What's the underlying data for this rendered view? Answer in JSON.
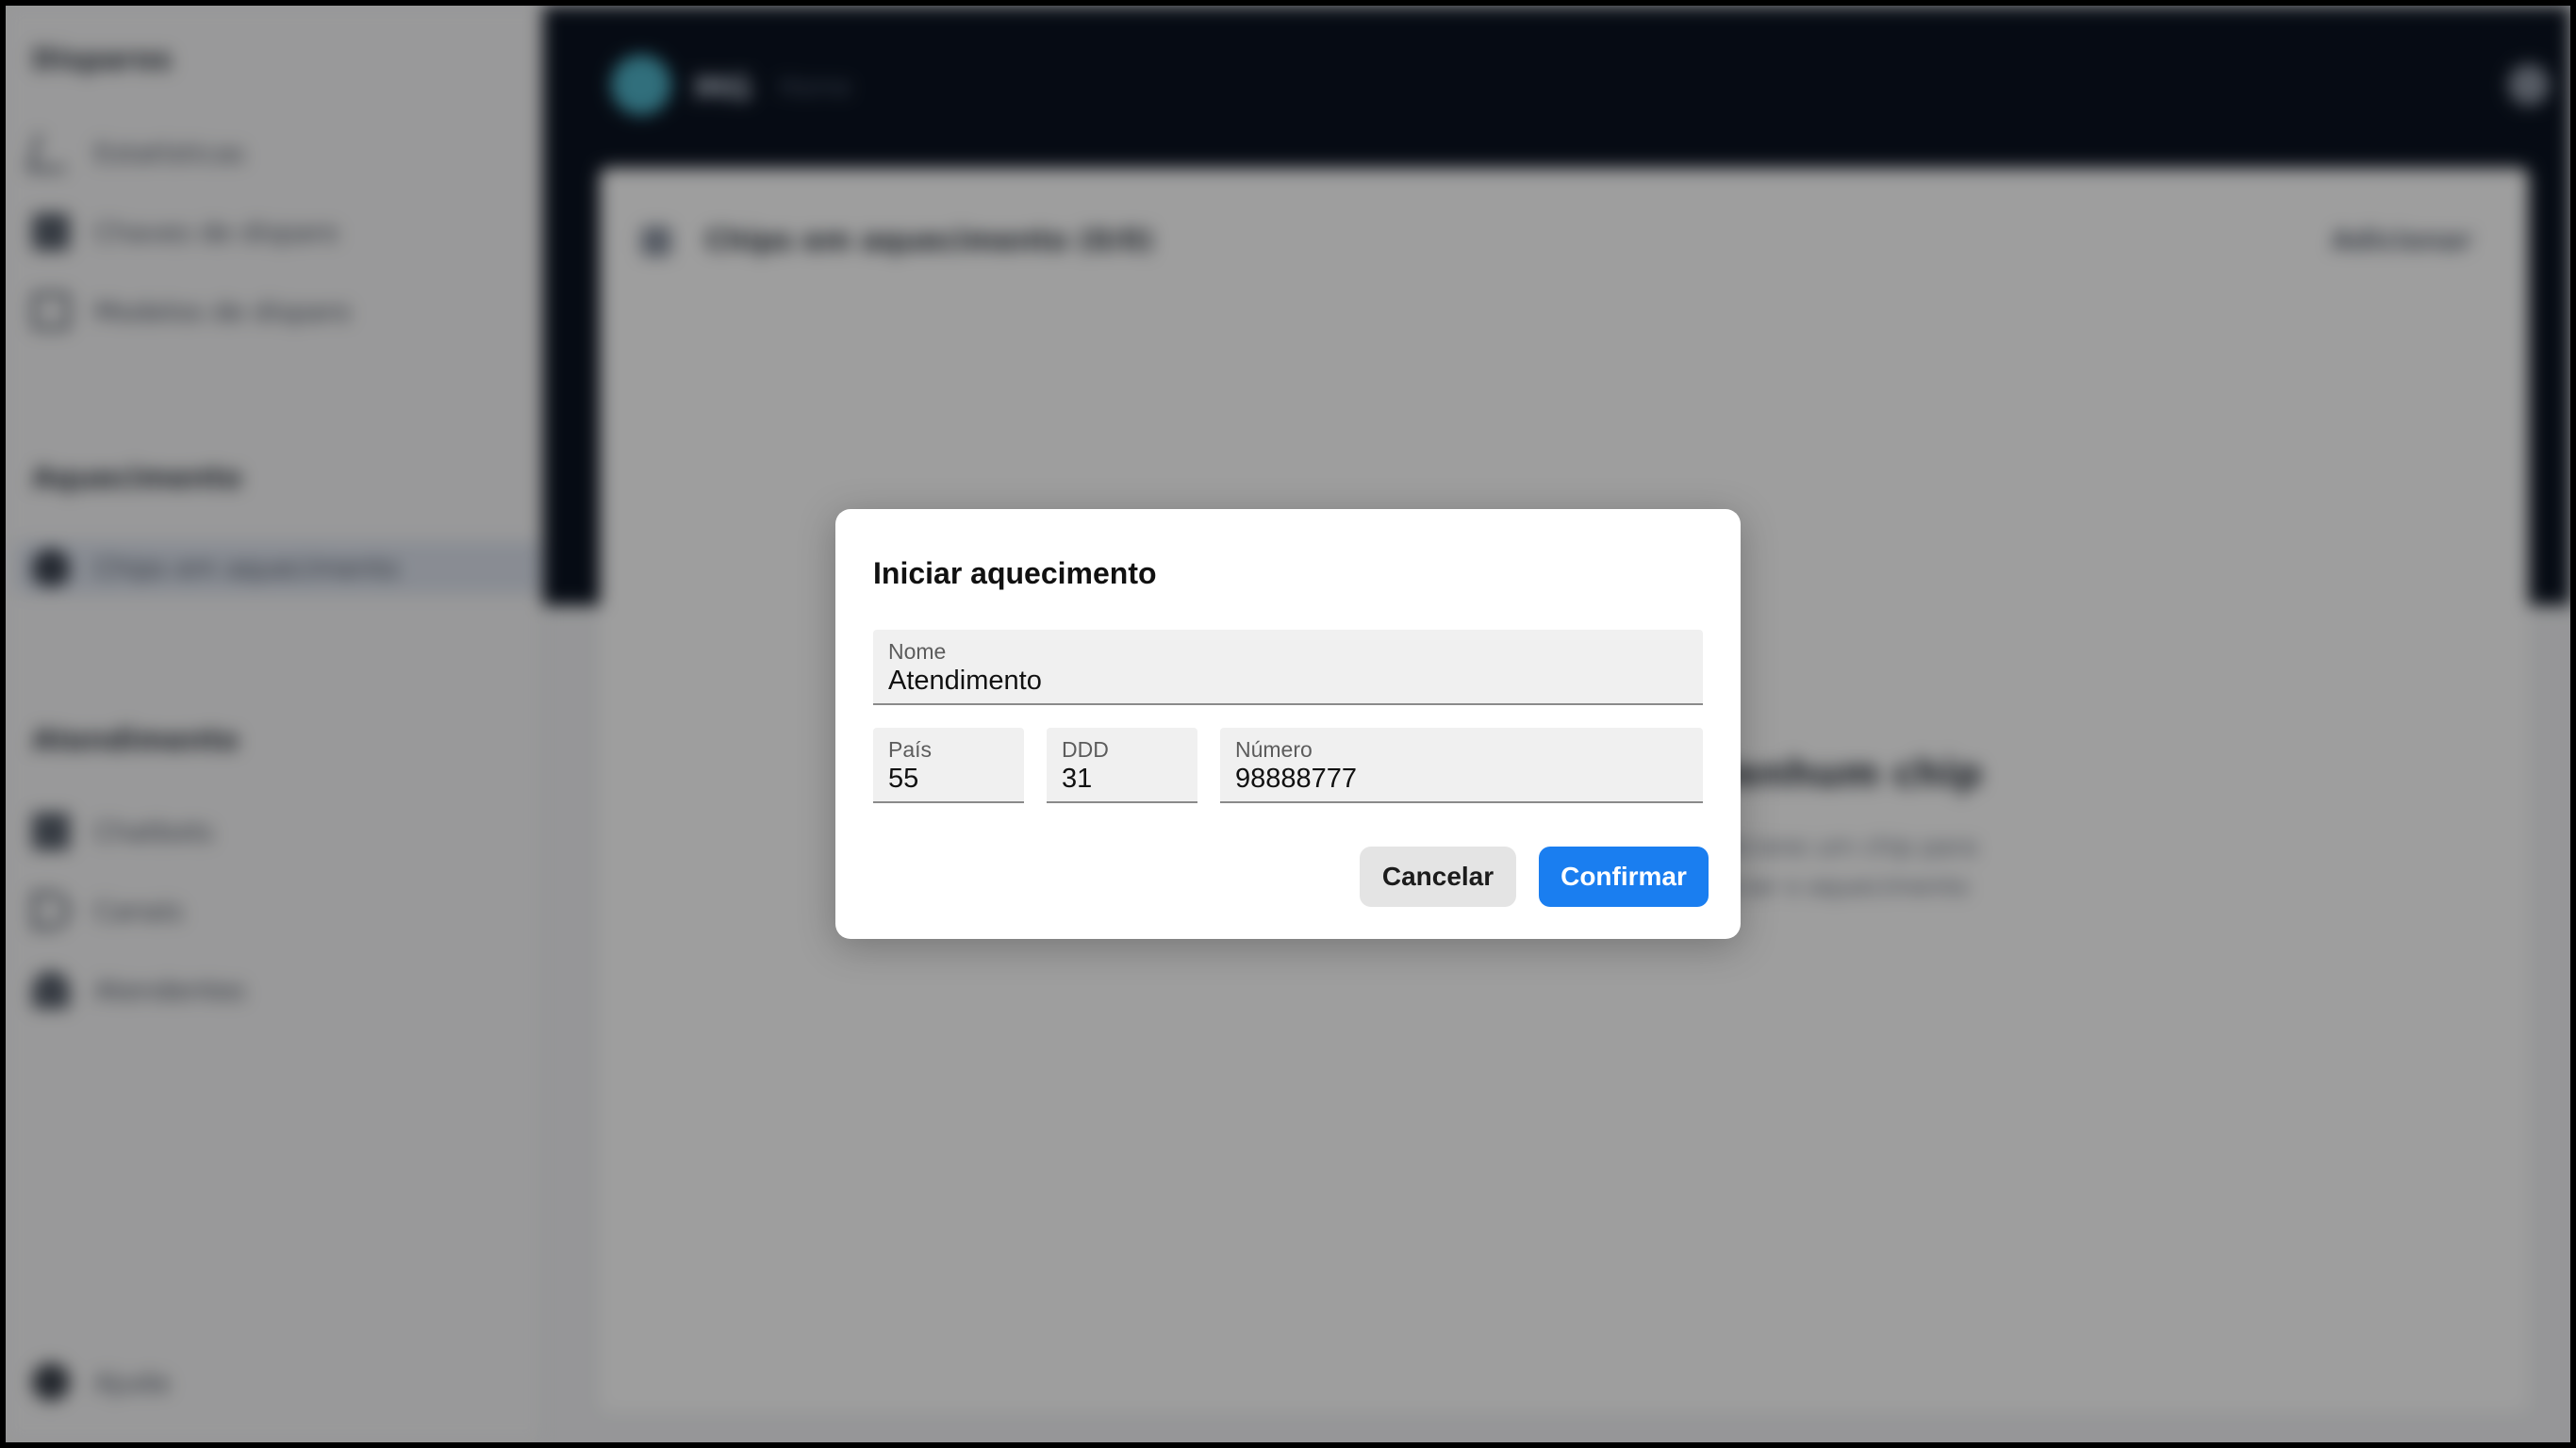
{
  "background": {
    "sidebar": {
      "sections": [
        {
          "title": "Disparos",
          "items": [
            {
              "label": "Estatísticas",
              "icon": "trend-icon"
            },
            {
              "label": "Chaves de disparo",
              "icon": "bag-icon"
            },
            {
              "label": "Modelos de disparo",
              "icon": "calendar-icon"
            }
          ]
        },
        {
          "title": "Aquecimento",
          "items": [
            {
              "label": "Chips em aquecimento",
              "icon": "fire-icon",
              "active": true
            }
          ]
        },
        {
          "title": "Atendimento",
          "items": [
            {
              "label": "Chatbots",
              "icon": "robot-icon"
            },
            {
              "label": "Canais",
              "icon": "channel-icon"
            },
            {
              "label": "Atendentes",
              "icon": "team-icon"
            }
          ]
        }
      ],
      "help_label": "Ajuda"
    },
    "topbar": {
      "brand": "MG",
      "breadcrumb": "Home"
    },
    "card": {
      "title": "Chips em aquecimento (0/0)",
      "add_label": "Adicionar",
      "empty_title": "Nenhum chip",
      "empty_text_1": "Adicione um chip para",
      "empty_text_2": "iniciar o aquecimento"
    }
  },
  "modal": {
    "title": "Iniciar aquecimento",
    "fields": {
      "nome": {
        "label": "Nome",
        "value": "Atendimento"
      },
      "pais": {
        "label": "País",
        "value": "55"
      },
      "ddd": {
        "label": "DDD",
        "value": "31"
      },
      "numero": {
        "label": "Número",
        "value": "98888777"
      }
    },
    "cancel_label": "Cancelar",
    "confirm_label": "Confirmar",
    "confirm_color": "#1a7ef0"
  }
}
